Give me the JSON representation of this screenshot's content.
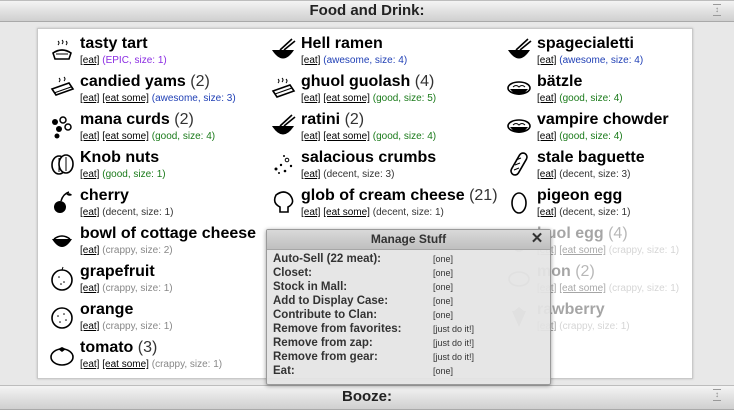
{
  "sections": {
    "food": "Food and Drink:",
    "booze": "Booze:"
  },
  "items": [
    {
      "name": "tasty tart",
      "count": "",
      "actions": [
        "[eat]"
      ],
      "desc": "(EPIC, size: 1)",
      "q": "epic",
      "icon": "tart-icon",
      "col": 0,
      "row": 0
    },
    {
      "name": "candied yams",
      "count": "(2)",
      "actions": [
        "[eat]",
        "[eat some]"
      ],
      "desc": "(awesome, size: 3)",
      "q": "awesome",
      "icon": "yams-icon",
      "col": 0,
      "row": 1
    },
    {
      "name": "mana curds",
      "count": "(2)",
      "actions": [
        "[eat]",
        "[eat some]"
      ],
      "desc": "(good, size: 4)",
      "q": "good",
      "icon": "curds-icon",
      "col": 0,
      "row": 2
    },
    {
      "name": "Knob nuts",
      "count": "",
      "actions": [
        "[eat]"
      ],
      "desc": "(good, size: 1)",
      "q": "good",
      "icon": "nuts-icon",
      "col": 0,
      "row": 3
    },
    {
      "name": "cherry",
      "count": "",
      "actions": [
        "[eat]"
      ],
      "desc": "(decent, size: 1)",
      "q": "decent",
      "icon": "cherry-icon",
      "col": 0,
      "row": 4
    },
    {
      "name": "bowl of cottage cheese",
      "count": "",
      "actions": [
        "[eat]"
      ],
      "desc": "(crappy, size: 2)",
      "q": "crappy",
      "icon": "cheese-bowl-icon",
      "col": 0,
      "row": 5
    },
    {
      "name": "grapefruit",
      "count": "",
      "actions": [
        "[eat]"
      ],
      "desc": "(crappy, size: 1)",
      "q": "crappy",
      "icon": "grapefruit-icon",
      "col": 0,
      "row": 6
    },
    {
      "name": "orange",
      "count": "",
      "actions": [
        "[eat]"
      ],
      "desc": "(crappy, size: 1)",
      "q": "crappy",
      "icon": "orange-icon",
      "col": 0,
      "row": 7
    },
    {
      "name": "tomato",
      "count": "(3)",
      "actions": [
        "[eat]",
        "[eat some]"
      ],
      "desc": "(crappy, size: 1)",
      "q": "crappy",
      "icon": "tomato-icon",
      "col": 0,
      "row": 8
    },
    {
      "name": "Hell ramen",
      "count": "",
      "actions": [
        "[eat]"
      ],
      "desc": "(awesome, size: 4)",
      "q": "awesome",
      "icon": "ramen-bowl-icon",
      "col": 1,
      "row": 0
    },
    {
      "name": "ghuol guolash",
      "count": "(4)",
      "actions": [
        "[eat]",
        "[eat some]"
      ],
      "desc": "(good, size: 5)",
      "q": "good",
      "icon": "steaming-food-icon",
      "col": 1,
      "row": 1
    },
    {
      "name": "ratini",
      "count": "(2)",
      "actions": [
        "[eat]",
        "[eat some]"
      ],
      "desc": "(good, size: 4)",
      "q": "good",
      "icon": "ramen-bowl-icon",
      "col": 1,
      "row": 2
    },
    {
      "name": "salacious crumbs",
      "count": "",
      "actions": [
        "[eat]"
      ],
      "desc": "(decent, size: 3)",
      "q": "decent",
      "icon": "crumbs-icon",
      "col": 1,
      "row": 3
    },
    {
      "name": "glob of cream cheese",
      "count": "(21)",
      "actions": [
        "[eat]",
        "[eat some]"
      ],
      "desc": "(decent, size: 1)",
      "q": "decent",
      "icon": "cream-cheese-icon",
      "col": 1,
      "row": 4
    },
    {
      "name": "spagecialetti",
      "count": "",
      "actions": [
        "[eat]"
      ],
      "desc": "(awesome, size: 4)",
      "q": "awesome",
      "icon": "ramen-bowl-icon",
      "col": 2,
      "row": 0
    },
    {
      "name": "bätzle",
      "count": "",
      "actions": [
        "[eat]"
      ],
      "desc": "(good, size: 4)",
      "q": "good",
      "icon": "dish-icon",
      "col": 2,
      "row": 1
    },
    {
      "name": "vampire chowder",
      "count": "",
      "actions": [
        "[eat]"
      ],
      "desc": "(good, size: 4)",
      "q": "good",
      "icon": "dish-icon",
      "col": 2,
      "row": 2
    },
    {
      "name": "stale baguette",
      "count": "",
      "actions": [
        "[eat]"
      ],
      "desc": "(decent, size: 3)",
      "q": "decent",
      "icon": "baguette-icon",
      "col": 2,
      "row": 3
    },
    {
      "name": "pigeon egg",
      "count": "",
      "actions": [
        "[eat]"
      ],
      "desc": "(decent, size: 1)",
      "q": "decent",
      "icon": "egg-icon",
      "col": 2,
      "row": 4
    },
    {
      "name": "huol egg",
      "count": "(4)",
      "actions": [
        "[eat]",
        "[eat some]"
      ],
      "desc": "(crappy, size: 1)",
      "q": "crappy",
      "icon": "egg-icon",
      "col": 2,
      "row": 5
    },
    {
      "name": "mon",
      "count": "(2)",
      "actions": [
        "[eat]",
        "[eat some]"
      ],
      "desc": "(crappy, size: 1)",
      "q": "crappy",
      "icon": "lemon-icon",
      "col": 2,
      "row": 6
    },
    {
      "name": "rawberry",
      "count": "",
      "actions": [
        "[eat]"
      ],
      "desc": "(crappy, size: 1)",
      "q": "crappy",
      "icon": "strawberry-icon",
      "col": 2,
      "row": 7
    }
  ],
  "modal": {
    "title": "Manage Stuff",
    "close": "✕",
    "rows": [
      {
        "label": "Auto-Sell (22 meat):",
        "opt": "[one]"
      },
      {
        "label": "Closet:",
        "opt": "[one]"
      },
      {
        "label": "Stock in Mall:",
        "opt": "[one]"
      },
      {
        "label": "Add to Display Case:",
        "opt": "[one]"
      },
      {
        "label": "Contribute to Clan:",
        "opt": "[one]"
      },
      {
        "label": "Remove from favorites:",
        "opt": "[just do it!]"
      },
      {
        "label": "Remove from zap:",
        "opt": "[just do it!]"
      },
      {
        "label": "Remove from gear:",
        "opt": "[just do it!]"
      },
      {
        "label": "Eat:",
        "opt": "[one]"
      }
    ]
  }
}
